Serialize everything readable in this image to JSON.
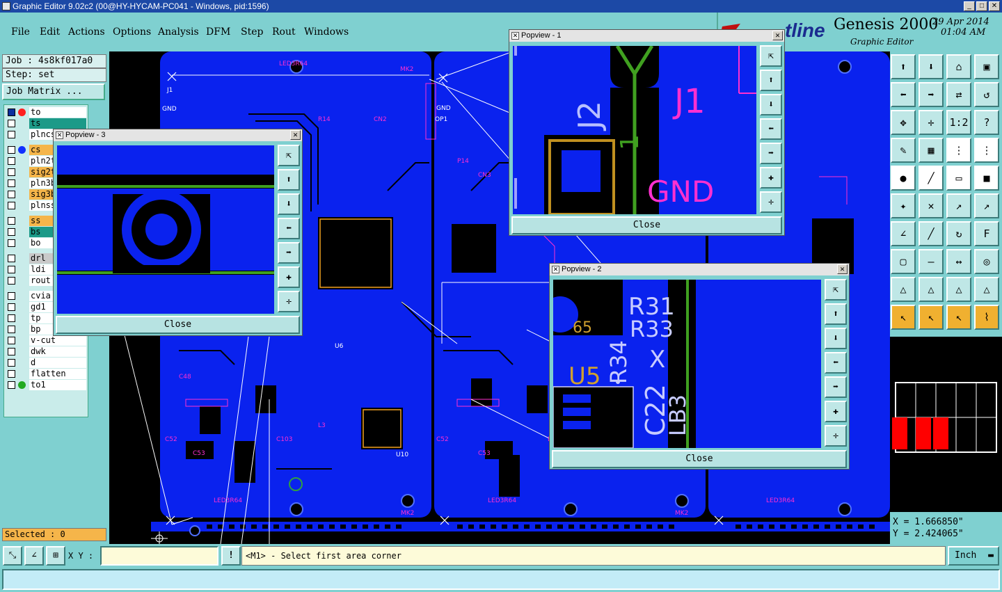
{
  "window": {
    "title": "Graphic Editor 9.02c2 (00@HY-HYCAM-PC041 - Windows, pid:1596)",
    "min": "_",
    "max": "□",
    "close": "✕"
  },
  "menu": [
    "File",
    "Edit",
    "Actions",
    "Options",
    "Analysis",
    "DFM",
    "Step",
    "Rout",
    "Windows"
  ],
  "logo": {
    "brand": "tline",
    "product": "Genesis 2000",
    "subtitle": "Graphic Editor",
    "date": "29 Apr 2014",
    "time": "01:04 AM"
  },
  "job": {
    "job": "Job : 4s8kf017a0",
    "step": "Step: set",
    "matrix_button": "Job Matrix ..."
  },
  "layers": [
    {
      "name": "to",
      "bg": "#ffffff",
      "dot": "#ff2020",
      "checked": true
    },
    {
      "name": "ts",
      "bg": "#1c9a88",
      "dot": "",
      "checked": false
    },
    {
      "name": "plncs",
      "bg": "#ffffff",
      "dot": "",
      "checked": false
    },
    {
      "name": "cs",
      "bg": "#f5b54a",
      "dot": "#1030ff",
      "checked": false
    },
    {
      "name": "pln2t",
      "bg": "#ffffff",
      "dot": "",
      "checked": false
    },
    {
      "name": "sig2t",
      "bg": "#f5b54a",
      "dot": "",
      "checked": false
    },
    {
      "name": "pln3b",
      "bg": "#ffffff",
      "dot": "",
      "checked": false
    },
    {
      "name": "sig3b",
      "bg": "#f5b54a",
      "dot": "",
      "checked": false
    },
    {
      "name": "plnss",
      "bg": "#ffffff",
      "dot": "",
      "checked": false
    },
    {
      "name": "ss",
      "bg": "#f5b54a",
      "dot": "",
      "checked": false
    },
    {
      "name": "bs",
      "bg": "#1c9a88",
      "dot": "",
      "checked": false
    },
    {
      "name": "bo",
      "bg": "#ffffff",
      "dot": "",
      "checked": false
    },
    {
      "name": "drl",
      "bg": "#c9c9c9",
      "dot": "",
      "checked": false
    },
    {
      "name": "ldi",
      "bg": "#ffffff",
      "dot": "",
      "checked": false
    },
    {
      "name": "rout",
      "bg": "#ffffff",
      "dot": "",
      "checked": false
    },
    {
      "name": "cvia",
      "bg": "#ffffff",
      "dot": "",
      "checked": false
    },
    {
      "name": "gd1",
      "bg": "#ffffff",
      "dot": "",
      "checked": false
    },
    {
      "name": "tp",
      "bg": "#ffffff",
      "dot": "",
      "checked": false
    },
    {
      "name": "bp",
      "bg": "#ffffff",
      "dot": "",
      "checked": false
    },
    {
      "name": "v-cut",
      "bg": "#ffffff",
      "dot": "",
      "checked": false
    },
    {
      "name": "dwk",
      "bg": "#ffffff",
      "dot": "",
      "checked": false
    },
    {
      "name": "d",
      "bg": "#ffffff",
      "dot": "",
      "checked": false
    },
    {
      "name": "flatten",
      "bg": "#ffffff",
      "dot": "",
      "checked": false
    },
    {
      "name": "to1",
      "bg": "#ffffff",
      "dot": "#22aa22",
      "checked": false
    }
  ],
  "selected": "Selected : 0",
  "popups": {
    "p1": {
      "title": "Popview - 1",
      "close": "Close",
      "labels": {
        "j2": "J2",
        "j1": "J1",
        "gnd": "GND",
        "one": "1"
      }
    },
    "p2": {
      "title": "Popview - 2",
      "close": "Close",
      "labels": {
        "r31": "R31",
        "r33": "R33",
        "r34": "R34",
        "c22": "C22",
        "lb3": "LB3",
        "x": "X",
        "u5": "U5",
        "n65": "65"
      }
    },
    "p3": {
      "title": "Popview - 3",
      "close": "Close"
    }
  },
  "canvas_labels": {
    "j1": "J1",
    "gnd": "GND",
    "op1": "OP1",
    "u6": "U6",
    "u10": "U10",
    "led": "LED3R64",
    "mk2": "MK2"
  },
  "coords": {
    "x": "X  = 1.666850\"",
    "y": "Y  = 2.424065\""
  },
  "bottom": {
    "xy_label": "X Y :",
    "xy_value": "",
    "warn": "!",
    "message": "<M1> - Select first area corner",
    "units": "Inch"
  },
  "colors": {
    "board": "#0a22ee",
    "accent": "#7fd0d0",
    "silk": "#ffffff",
    "magenta": "#ff30d0",
    "green": "#3aa020"
  }
}
